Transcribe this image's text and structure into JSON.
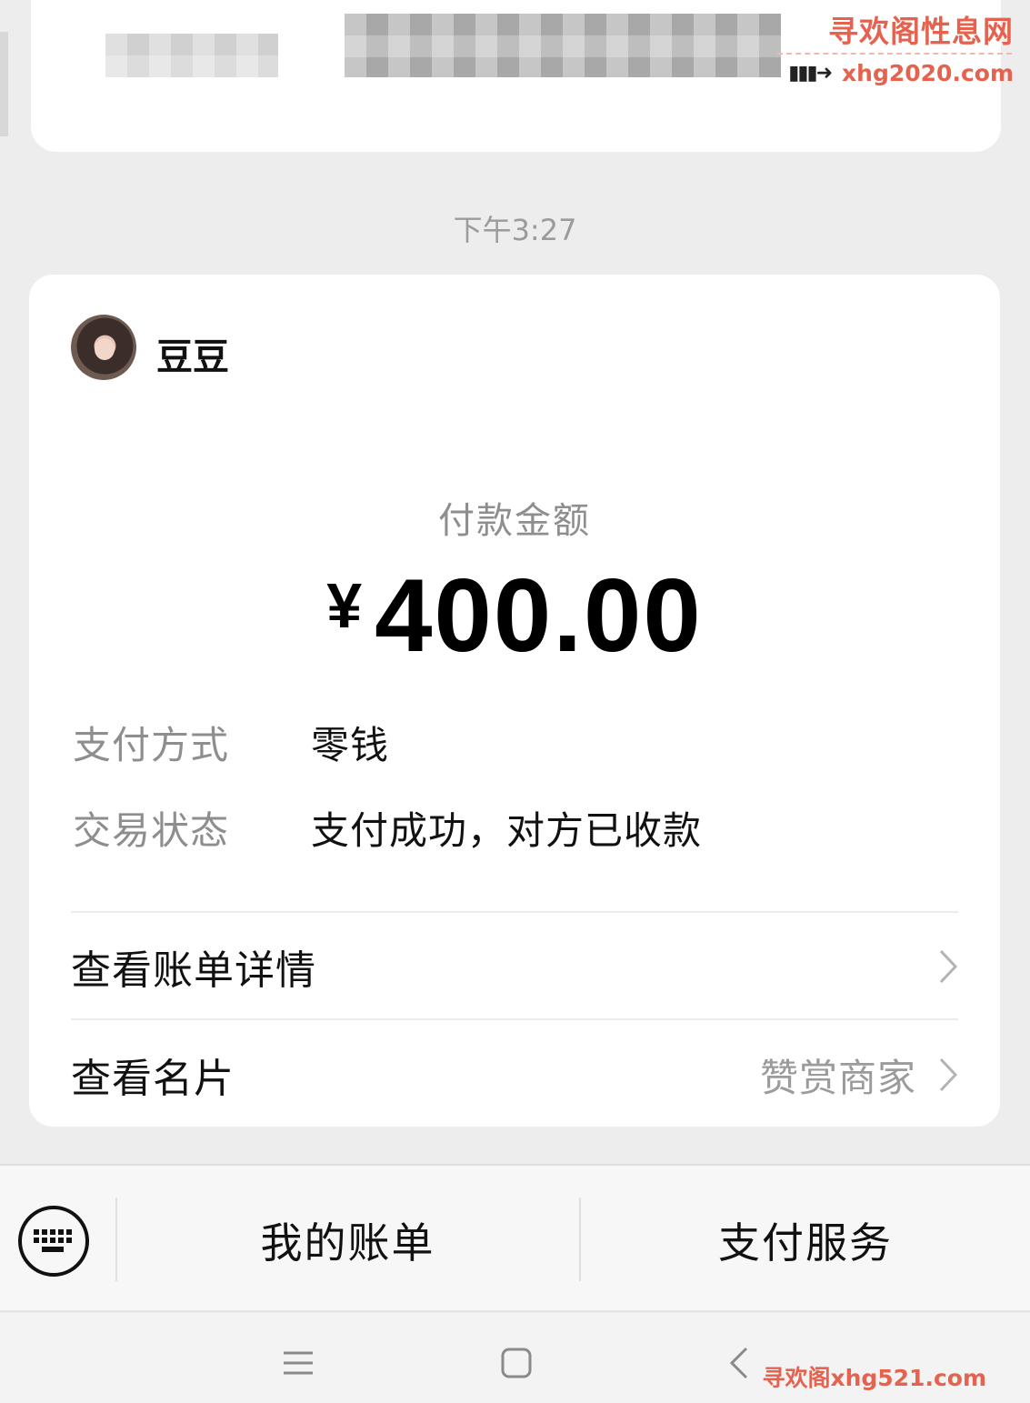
{
  "watermark": {
    "top_title": "寻欢阁性息网",
    "top_url": "xhg2020.com",
    "bottom_text": "寻欢阁xhg521.com"
  },
  "chat": {
    "timestamp": "下午3:27"
  },
  "payment_card": {
    "payee_name": "豆豆",
    "amount_label": "付款金额",
    "currency_symbol": "¥",
    "amount": "400.00",
    "method_label": "支付方式",
    "method_value": "零钱",
    "status_label": "交易状态",
    "status_value": "支付成功，对方已收款",
    "bill_details_label": "查看账单详情",
    "business_card_label": "查看名片",
    "reward_label": "赞赏商家"
  },
  "menu_bar": {
    "my_bills": "我的账单",
    "pay_services": "支付服务"
  },
  "colors": {
    "background": "#ededed",
    "watermark_red": "#e5624f",
    "muted_text": "#8e8e8e"
  }
}
